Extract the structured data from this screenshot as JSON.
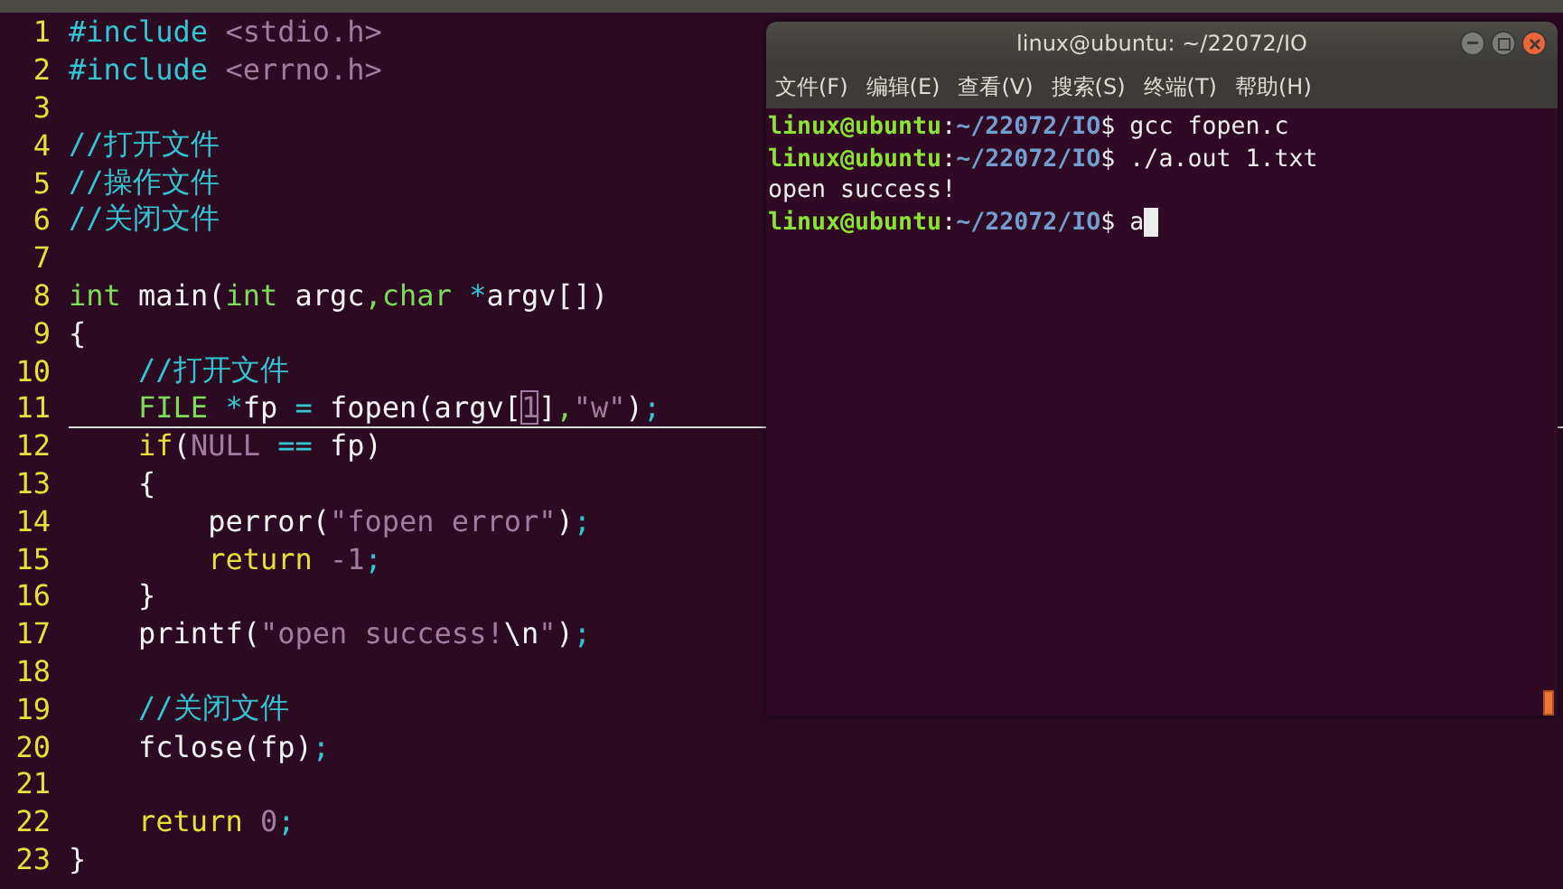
{
  "editor": {
    "lines": [
      {
        "number": "1",
        "cursor_line": false,
        "tokens": [
          {
            "kind": "preproc",
            "text": "#include"
          },
          {
            "kind": "string",
            "text": " <stdio.h>"
          }
        ]
      },
      {
        "number": "2",
        "cursor_line": false,
        "tokens": [
          {
            "kind": "preproc",
            "text": "#include"
          },
          {
            "kind": "string",
            "text": " <errno.h>"
          }
        ]
      },
      {
        "number": "3",
        "cursor_line": false
      },
      {
        "number": "4",
        "cursor_line": false,
        "tokens": [
          {
            "kind": "comment",
            "text": "//打开文件"
          }
        ]
      },
      {
        "number": "5",
        "cursor_line": false,
        "tokens": [
          {
            "kind": "comment",
            "text": "//操作文件"
          }
        ]
      },
      {
        "number": "6",
        "cursor_line": false,
        "tokens": [
          {
            "kind": "comment",
            "text": "//关闭文件"
          }
        ]
      },
      {
        "number": "7",
        "cursor_line": false
      },
      {
        "number": "8",
        "cursor_line": false,
        "tokens": [
          {
            "kind": "type",
            "text": "int"
          },
          {
            "kind": "plain",
            "text": " main("
          },
          {
            "kind": "type",
            "text": "int"
          },
          {
            "kind": "plain",
            "text": " argc"
          },
          {
            "kind": "type",
            "text": ",char"
          },
          {
            "kind": "operator",
            "text": " *"
          },
          {
            "kind": "plain",
            "text": "argv[])"
          }
        ]
      },
      {
        "number": "9",
        "cursor_line": false,
        "tokens": [
          {
            "kind": "plain",
            "text": "{"
          }
        ]
      },
      {
        "number": "10",
        "cursor_line": false,
        "tokens": [
          {
            "kind": "comment",
            "text": "    //打开文件"
          }
        ]
      },
      {
        "number": "11",
        "cursor_line": true,
        "tokens": [
          {
            "kind": "type",
            "text": "    FILE"
          },
          {
            "kind": "operator",
            "text": " *"
          },
          {
            "kind": "plain",
            "text": "fp "
          },
          {
            "kind": "operator",
            "text": "="
          },
          {
            "kind": "plain",
            "text": " fopen(argv["
          },
          {
            "kind": "number",
            "text": "1",
            "cursor": true
          },
          {
            "kind": "plain",
            "text": "]"
          },
          {
            "kind": "type",
            "text": ","
          },
          {
            "kind": "string",
            "text": "\"w\""
          },
          {
            "kind": "plain",
            "text": ")"
          },
          {
            "kind": "operator",
            "text": ";"
          }
        ]
      },
      {
        "number": "12",
        "cursor_line": false,
        "tokens": [
          {
            "kind": "keyword",
            "text": "    if"
          },
          {
            "kind": "plain",
            "text": "("
          },
          {
            "kind": "number",
            "text": "NULL"
          },
          {
            "kind": "operator",
            "text": " =="
          },
          {
            "kind": "plain",
            "text": " fp)"
          }
        ]
      },
      {
        "number": "13",
        "cursor_line": false,
        "tokens": [
          {
            "kind": "plain",
            "text": "    {"
          }
        ]
      },
      {
        "number": "14",
        "cursor_line": false,
        "tokens": [
          {
            "kind": "plain",
            "text": "        perror("
          },
          {
            "kind": "string",
            "text": "\"fopen error\""
          },
          {
            "kind": "plain",
            "text": ")"
          },
          {
            "kind": "operator",
            "text": ";"
          }
        ]
      },
      {
        "number": "15",
        "cursor_line": false,
        "tokens": [
          {
            "kind": "keyword",
            "text": "        return"
          },
          {
            "kind": "number",
            "text": " -1"
          },
          {
            "kind": "operator",
            "text": ";"
          }
        ]
      },
      {
        "number": "16",
        "cursor_line": false,
        "tokens": [
          {
            "kind": "plain",
            "text": "    }"
          }
        ]
      },
      {
        "number": "17",
        "cursor_line": false,
        "tokens": [
          {
            "kind": "plain",
            "text": "    printf("
          },
          {
            "kind": "string",
            "text": "\"open success!"
          },
          {
            "kind": "plain",
            "text": "\\n"
          },
          {
            "kind": "string",
            "text": "\""
          },
          {
            "kind": "plain",
            "text": ")"
          },
          {
            "kind": "operator",
            "text": ";"
          }
        ]
      },
      {
        "number": "18",
        "cursor_line": false
      },
      {
        "number": "19",
        "cursor_line": false,
        "tokens": [
          {
            "kind": "comment",
            "text": "    //关闭文件"
          }
        ]
      },
      {
        "number": "20",
        "cursor_line": false,
        "tokens": [
          {
            "kind": "plain",
            "text": "    fclose(fp)"
          },
          {
            "kind": "operator",
            "text": ";"
          }
        ]
      },
      {
        "number": "21",
        "cursor_line": false
      },
      {
        "number": "22",
        "cursor_line": false,
        "tokens": [
          {
            "kind": "keyword",
            "text": "    return"
          },
          {
            "kind": "number",
            "text": " 0"
          },
          {
            "kind": "operator",
            "text": ";"
          }
        ]
      },
      {
        "number": "23",
        "cursor_line": false,
        "tokens": [
          {
            "kind": "plain",
            "text": "}"
          }
        ]
      }
    ]
  },
  "terminal": {
    "title": "linux@ubuntu: ~/22072/IO",
    "menu": [
      "文件(F)",
      "编辑(E)",
      "查看(V)",
      "搜索(S)",
      "终端(T)",
      "帮助(H)"
    ],
    "lines": [
      {
        "kind": "command",
        "user": "linux@ubuntu",
        "separator": ":",
        "path": "~/22072/IO",
        "symbol": "$",
        "command": " gcc fopen.c",
        "cursor": false
      },
      {
        "kind": "command",
        "user": "linux@ubuntu",
        "separator": ":",
        "path": "~/22072/IO",
        "symbol": "$",
        "command": " ./a.out 1.txt",
        "cursor": false
      },
      {
        "kind": "output",
        "text": "open success!"
      },
      {
        "kind": "command",
        "user": "linux@ubuntu",
        "separator": ":",
        "path": "~/22072/IO",
        "symbol": "$",
        "command": " a",
        "cursor": true
      }
    ]
  }
}
